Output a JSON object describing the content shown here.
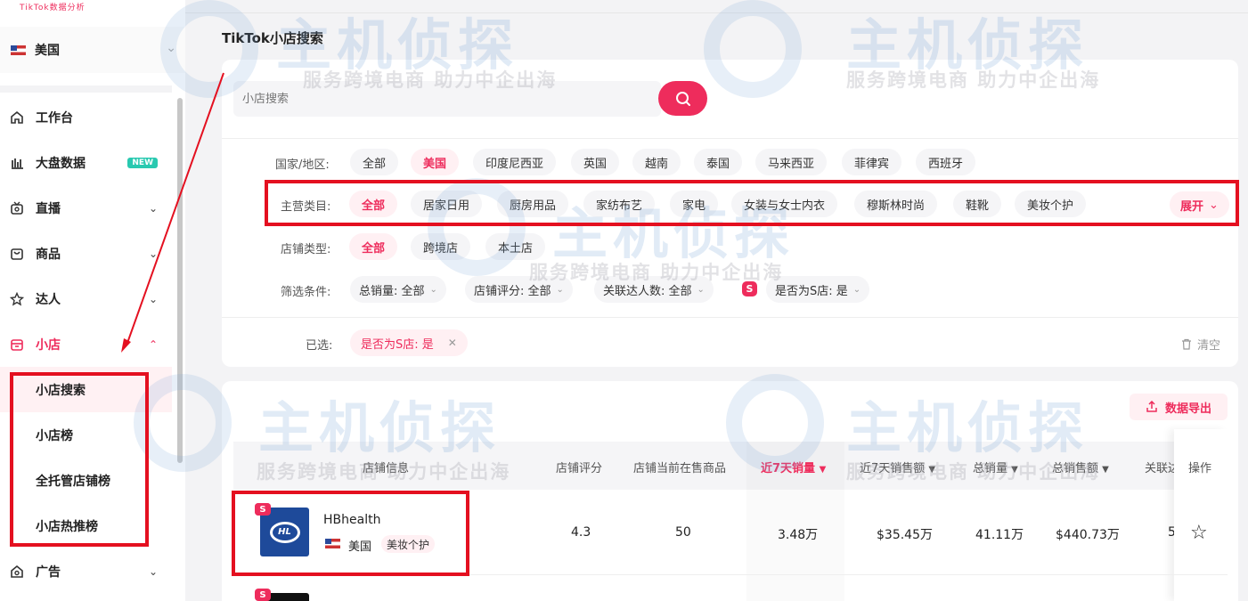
{
  "app": {
    "logo_text": "TikTok数据分析",
    "page_title": "TikTok小店搜索"
  },
  "sidebar": {
    "region": "美国",
    "items": [
      {
        "label": "工作台",
        "icon": "home-icon"
      },
      {
        "label": "大盘数据",
        "icon": "bar-chart-icon",
        "badge": "NEW"
      },
      {
        "label": "直播",
        "icon": "live-icon"
      },
      {
        "label": "商品",
        "icon": "bag-icon"
      },
      {
        "label": "达人",
        "icon": "star-icon"
      },
      {
        "label": "小店",
        "icon": "shop-icon"
      },
      {
        "label": "广告",
        "icon": "ad-icon"
      }
    ],
    "shop_sub": [
      "小店搜索",
      "小店榜",
      "全托管店铺榜",
      "小店热推榜"
    ]
  },
  "search": {
    "placeholder": "小店搜索"
  },
  "filters": {
    "country_label": "国家/地区:",
    "countries": [
      "全部",
      "美国",
      "印度尼西亚",
      "英国",
      "越南",
      "泰国",
      "马来西亚",
      "菲律宾",
      "西班牙"
    ],
    "category_label": "主营类目:",
    "categories": [
      "全部",
      "居家日用",
      "厨房用品",
      "家纺布艺",
      "家电",
      "女装与女士内衣",
      "穆斯林时尚",
      "鞋靴",
      "美妆个护"
    ],
    "expand": "展开",
    "store_type_label": "店铺类型:",
    "store_types": [
      "全部",
      "跨境店",
      "本土店"
    ],
    "conditions_label": "筛选条件:",
    "conditions": [
      "总销量: 全部",
      "店铺评分: 全部",
      "关联达人数: 全部",
      "是否为S店: 是"
    ],
    "selected_label": "已选:",
    "selected_tag": "是否为S店: 是",
    "clear": "清空"
  },
  "table": {
    "export": "数据导出",
    "headers": [
      "店铺信息",
      "店铺评分",
      "店铺当前在售商品",
      "近7天销量",
      "近7天销售额",
      "总销量",
      "总销售额",
      "关联达",
      "操作"
    ],
    "rows": [
      {
        "name": "HBhealth",
        "country": "美国",
        "category": "美妆个护",
        "rating": "4.3",
        "products": "50",
        "sales7": "3.48万",
        "revenue7": "$35.45万",
        "total_sales": "41.11万",
        "total_revenue": "$440.73万",
        "influencers": "5"
      }
    ]
  },
  "watermark": {
    "brand": "主机侦探",
    "slogan": "服务跨境电商 助力中企出海"
  },
  "colors": {
    "accent": "#ee2c5c",
    "annotation": "#e41020"
  }
}
